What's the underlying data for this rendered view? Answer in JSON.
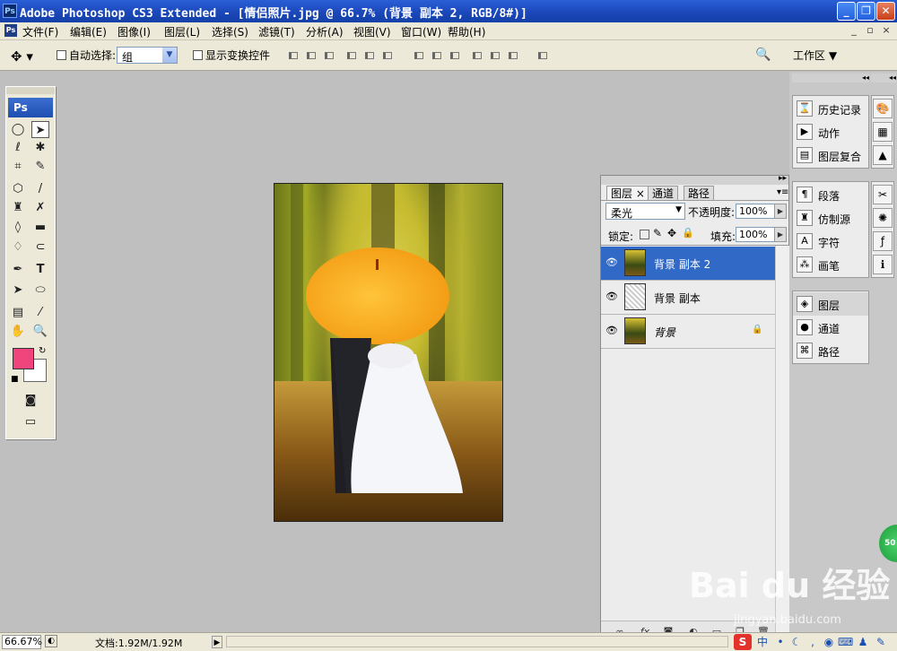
{
  "window": {
    "app_icon": "Ps",
    "title": "Adobe Photoshop CS3 Extended - [情侣照片.jpg @ 66.7% (背景 副本 2, RGB/8#)]",
    "minimize_icon": "minimize-icon",
    "maximize_icon": "restore-icon",
    "close_icon": "close-icon"
  },
  "menubar": {
    "doc_icon": "Ps",
    "items": [
      "文件(F)",
      "编辑(E)",
      "图像(I)",
      "图层(L)",
      "选择(S)",
      "滤镜(T)",
      "分析(A)",
      "视图(V)",
      "窗口(W)",
      "帮助(H)"
    ],
    "doc_controls": [
      "_",
      "▫",
      "×"
    ]
  },
  "options": {
    "auto_select_label": "自动选择:",
    "auto_select_value": "组",
    "show_transform_label": "显示变换控件",
    "workspace_label": "工作区 ▼"
  },
  "toolbox": {
    "header": "Ps",
    "foreground_color": "#f0447c",
    "background_color": "#ffffff"
  },
  "canvas": {
    "image_name": "情侣照片.jpg",
    "umbrella_color": "#f5a623"
  },
  "layers_panel": {
    "tabs": [
      "图层 ×",
      "通道",
      "路径"
    ],
    "blend_mode": "柔光",
    "opacity_label": "不透明度:",
    "opacity_value": "100%",
    "lock_label": "锁定:",
    "fill_label": "填充:",
    "fill_value": "100%",
    "layers": [
      {
        "name": "背景 副本 2",
        "selected": true,
        "visible": true
      },
      {
        "name": "背景 副本",
        "selected": false,
        "visible": true
      },
      {
        "name": "背景",
        "selected": false,
        "visible": true,
        "locked": true
      }
    ]
  },
  "dock": {
    "group1": [
      "历史记录",
      "动作",
      "图层复合"
    ],
    "group2": [
      "段落",
      "仿制源",
      "字符",
      "画笔"
    ],
    "group3": [
      "图层",
      "通道",
      "路径"
    ]
  },
  "status": {
    "zoom": "66.67%",
    "doc_info": "文档:1.92M/1.92M"
  },
  "watermark": {
    "text": "Bai du 经验",
    "sub": "jingyan.baidu.com",
    "badge": "50"
  }
}
